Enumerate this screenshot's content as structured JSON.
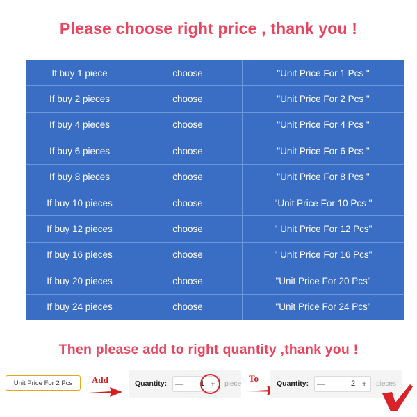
{
  "headings": {
    "top": "Please choose right price , thank you !",
    "bottom": "Then please add to right quantity ,thank you !",
    "color": "#e8455f"
  },
  "price_table": {
    "accent_color": "#3a6ec4",
    "border_color": "#6f96d6",
    "text_color": "#ffffff",
    "columns": [
      "quantity",
      "action",
      "price_label"
    ],
    "rows": [
      {
        "quantity": "If buy  1  piece",
        "action": "choose",
        "price_label": "\"Unit Price For  1  Pcs \""
      },
      {
        "quantity": "If buy 2  pieces",
        "action": "choose",
        "price_label": "\"Unit Price For  2  Pcs \""
      },
      {
        "quantity": "If buy  4  pieces",
        "action": "choose",
        "price_label": "\"Unit Price For  4 Pcs \""
      },
      {
        "quantity": "If buy  6  pieces",
        "action": "choose",
        "price_label": "\"Unit Price For  6  Pcs \""
      },
      {
        "quantity": "If  buy  8  pieces",
        "action": "choose",
        "price_label": "\"Unit Price For  8  Pcs \""
      },
      {
        "quantity": "If buy  10  pieces",
        "action": "choose",
        "price_label": "\"Unit Price For  10  Pcs \""
      },
      {
        "quantity": "If buy  12  pieces",
        "action": "choose",
        "price_label": "\" Unit Price For  12 Pcs\""
      },
      {
        "quantity": "If buy  16  pieces",
        "action": "choose",
        "price_label": "\" Unit Price For  16  Pcs\""
      },
      {
        "quantity": "If buy  20  pieces",
        "action": "choose",
        "price_label": "\"Unit Price For  20  Pcs\""
      },
      {
        "quantity": "If buy  24  pieces",
        "action": "choose",
        "price_label": "\"Unit Price For  24  Pcs\""
      }
    ]
  },
  "action_bar": {
    "variant_chip": {
      "label": "Unit Price For 2 Pcs",
      "border_color": "#e3a81b"
    },
    "annotations": {
      "add": {
        "word": "Add",
        "icon": "right-arrow-icon",
        "color": "#d32020"
      },
      "to": {
        "word": "To",
        "icon": "right-arrow-icon",
        "color": "#d32020"
      }
    },
    "quantity_before": {
      "label": "Quantity:",
      "decrement": "—",
      "value": "1",
      "increment": "+",
      "unit": "piece",
      "highlight_color": "#d8232a"
    },
    "quantity_after": {
      "label": "Quantity:",
      "decrement": "—",
      "value": "2",
      "increment": "+",
      "unit": "pieces"
    },
    "confirm_mark": {
      "icon": "check-mark-icon",
      "color": "#d8232a"
    }
  }
}
